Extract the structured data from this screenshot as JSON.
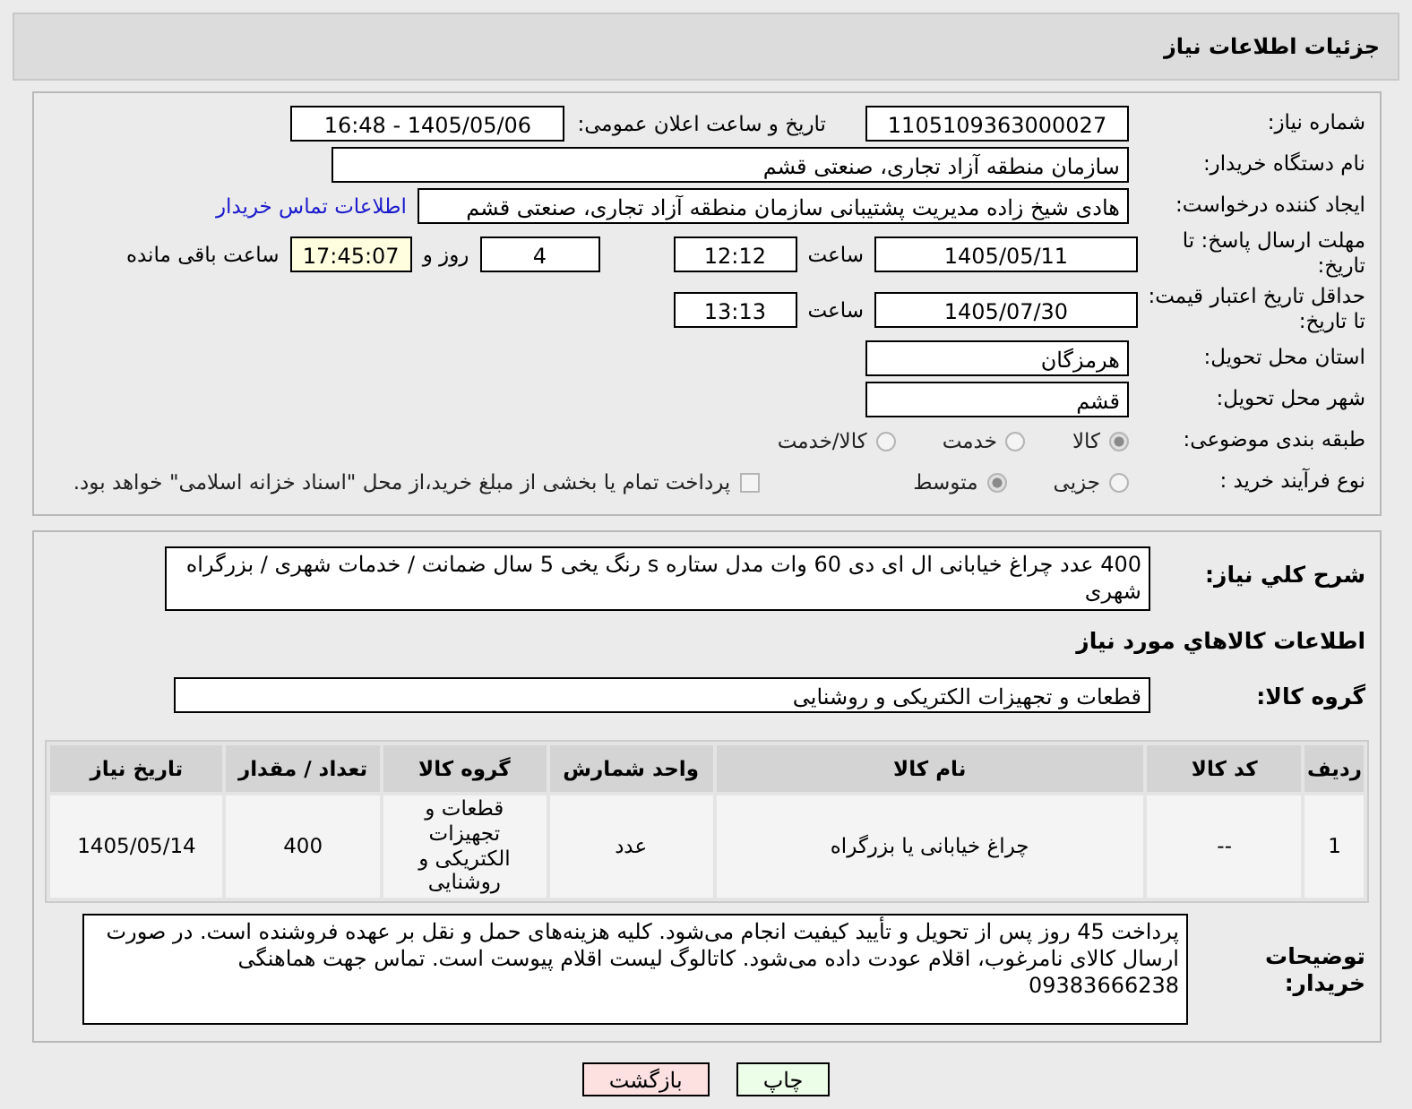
{
  "header": {
    "title": "جزئیات اطلاعات نیاز"
  },
  "need_number": {
    "label": "شماره نیاز:",
    "value": "1105109363000027"
  },
  "announce": {
    "label": "تاریخ و ساعت اعلان عمومی:",
    "value": "1405/05/06 - 16:48"
  },
  "buyer_org": {
    "label": "نام دستگاه خریدار:",
    "value": "سازمان منطقه آزاد تجاری، صنعتی قشم"
  },
  "creator": {
    "label": "ایجاد کننده درخواست:",
    "value": "هادی شیخ زاده  مدیریت پشتیبانی سازمان منطقه آزاد تجاری، صنعتی قشم",
    "link": "اطلاعات تماس خریدار"
  },
  "deadline": {
    "label": "مهلت ارسال پاسخ: تا تاریخ:",
    "date": "1405/05/11",
    "time_label": "ساعت",
    "time": "12:12",
    "days": "4",
    "days_label": "روز و",
    "remaining": "17:45:07",
    "remaining_label": "ساعت باقی مانده"
  },
  "validity": {
    "label": "حداقل تاریخ اعتبار قیمت: تا تاریخ:",
    "date": "1405/07/30",
    "time_label": "ساعت",
    "time": "13:13"
  },
  "province": {
    "label": "استان محل تحویل:",
    "value": "هرمزگان"
  },
  "city": {
    "label": "شهر محل تحویل:",
    "value": "قشم"
  },
  "category": {
    "label": "طبقه بندی موضوعی:",
    "options": [
      {
        "label": "کالا",
        "selected": true
      },
      {
        "label": "خدمت",
        "selected": false
      },
      {
        "label": "کالا/خدمت",
        "selected": false
      }
    ]
  },
  "process": {
    "label": "نوع فرآیند خرید :",
    "options": [
      {
        "label": "جزیی",
        "selected": false
      },
      {
        "label": "متوسط",
        "selected": true
      }
    ],
    "checkbox": {
      "label": "پرداخت تمام یا بخشی از مبلغ خرید،از محل \"اسناد خزانه اسلامی\" خواهد بود.",
      "checked": false
    }
  },
  "description": {
    "label": "شرح کلي نياز:",
    "value": "400 عدد چراغ خیابانی ال ای دی 60 وات  مدل ستاره s  رنگ یخی 5 سال ضمانت / خدمات شهری / بزرگراه شهری"
  },
  "goods_heading": "اطلاعات کالاهاي مورد نياز",
  "goods_group": {
    "label": "گروه کالا:",
    "value": "قطعات و تجهیزات الکتریکی و روشنایی"
  },
  "table": {
    "columns": [
      "ردیف",
      "کد کالا",
      "نام کالا",
      "واحد شمارش",
      "گروه کالا",
      "تعداد / مقدار",
      "تاریخ نیاز"
    ],
    "rows": [
      [
        "1",
        "--",
        "چراغ خیابانی یا بزرگراه",
        "عدد",
        "قطعات و تجهیزات الکتریکی و روشنایی",
        "400",
        "1405/05/14"
      ]
    ]
  },
  "buyer_notes": {
    "label": "توضیحات خریدار:",
    "value": "پرداخت 45 روز پس از تحویل و تأیید کیفیت انجام می‌شود. کلیه هزینه‌های حمل و نقل  بر عهده فروشنده است. در صورت ارسال کالای نامرغوب، اقلام عودت داده می‌شود. کاتالوگ لیست اقلام  پیوست است. تماس جهت هماهنگی 09383666238"
  },
  "buttons": [
    {
      "label": "چاپ",
      "kind": "print"
    },
    {
      "label": "بازگشت",
      "kind": "back"
    }
  ]
}
